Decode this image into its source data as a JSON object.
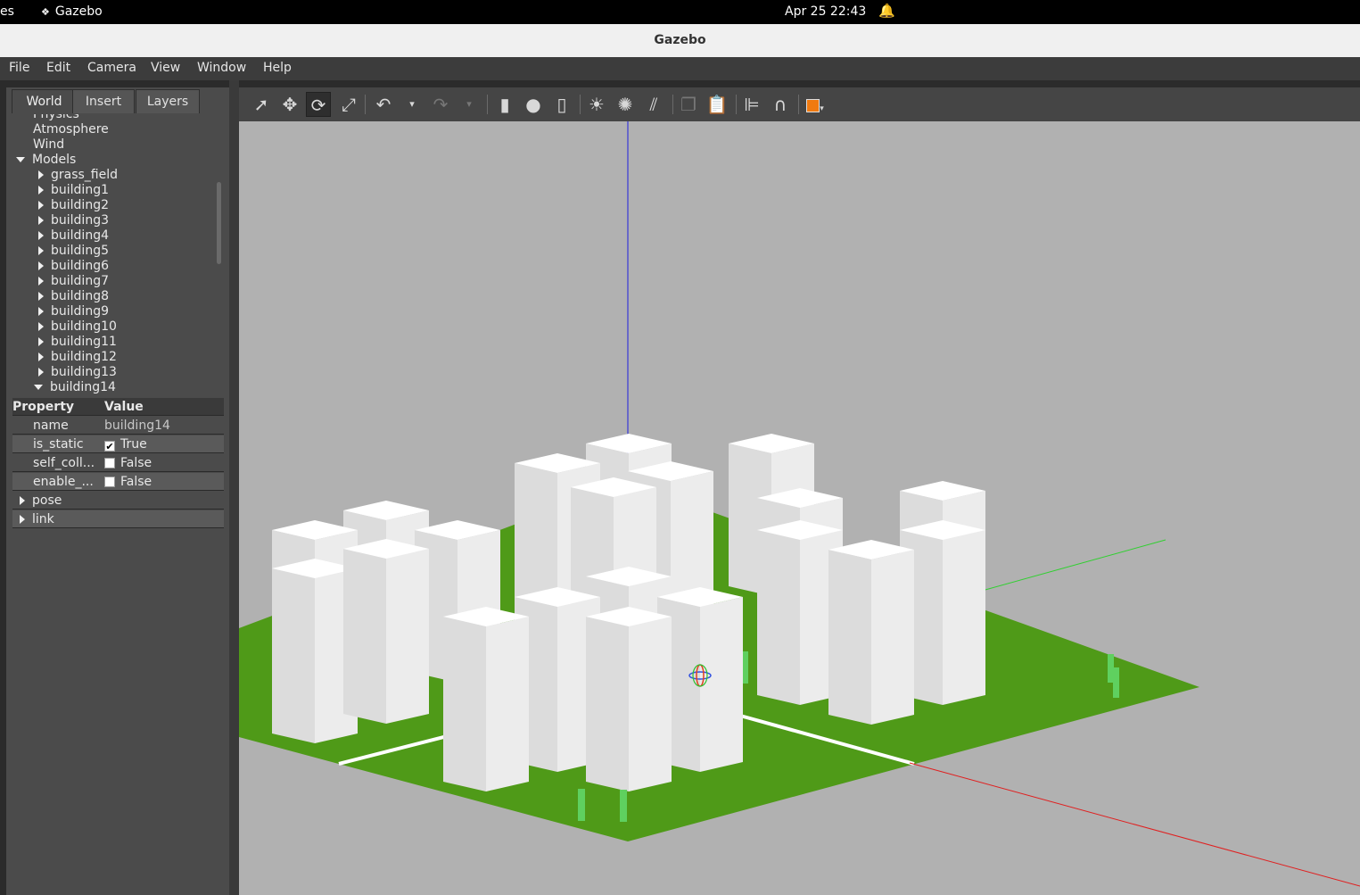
{
  "system_bar": {
    "activities": "es",
    "app_name": "Gazebo",
    "datetime": "Apr 25  22:43"
  },
  "window": {
    "title": "Gazebo"
  },
  "menu": [
    {
      "label": "File"
    },
    {
      "label": "Edit"
    },
    {
      "label": "Camera"
    },
    {
      "label": "View"
    },
    {
      "label": "Window"
    },
    {
      "label": "Help"
    }
  ],
  "tabs": [
    {
      "label": "World",
      "active": true
    },
    {
      "label": "Insert"
    },
    {
      "label": "Layers"
    }
  ],
  "tree": {
    "partial_top": "Physics",
    "items": [
      "Atmosphere",
      "Wind"
    ],
    "models_label": "Models",
    "models": [
      "grass_field",
      "building1",
      "building2",
      "building3",
      "building4",
      "building5",
      "building6",
      "building7",
      "building8",
      "building9",
      "building10",
      "building11",
      "building12",
      "building13",
      "building14"
    ]
  },
  "properties": {
    "header_property": "Property",
    "header_value": "Value",
    "rows": [
      {
        "key": "name",
        "value": "building14"
      },
      {
        "key": "is_static",
        "value": "True",
        "checked": true
      },
      {
        "key": "self_coll...",
        "value": "False",
        "checked": false
      },
      {
        "key": "enable_...",
        "value": "False",
        "checked": false
      }
    ],
    "groups": [
      "pose",
      "link"
    ]
  },
  "toolbar_icons": [
    "select-mode-icon",
    "translate-mode-icon",
    "rotate-mode-icon",
    "scale-mode-icon",
    "undo-icon",
    "undo-dropdown-icon",
    "redo-icon",
    "redo-dropdown-icon",
    "box-shape-icon",
    "sphere-shape-icon",
    "cylinder-shape-icon",
    "point-light-icon",
    "spot-light-icon",
    "directional-light-icon",
    "copy-icon",
    "paste-icon",
    "align-icon",
    "snap-magnet-icon",
    "view-angle-icon"
  ],
  "colors": {
    "grass": "#4f9a18",
    "building_top": "#ffffff",
    "building_left": "#dcdcdc",
    "building_right": "#ececec",
    "sky": "#b1b1b1",
    "axis_x": "#e02020",
    "axis_y": "#30d030",
    "axis_z": "#2020e0"
  }
}
